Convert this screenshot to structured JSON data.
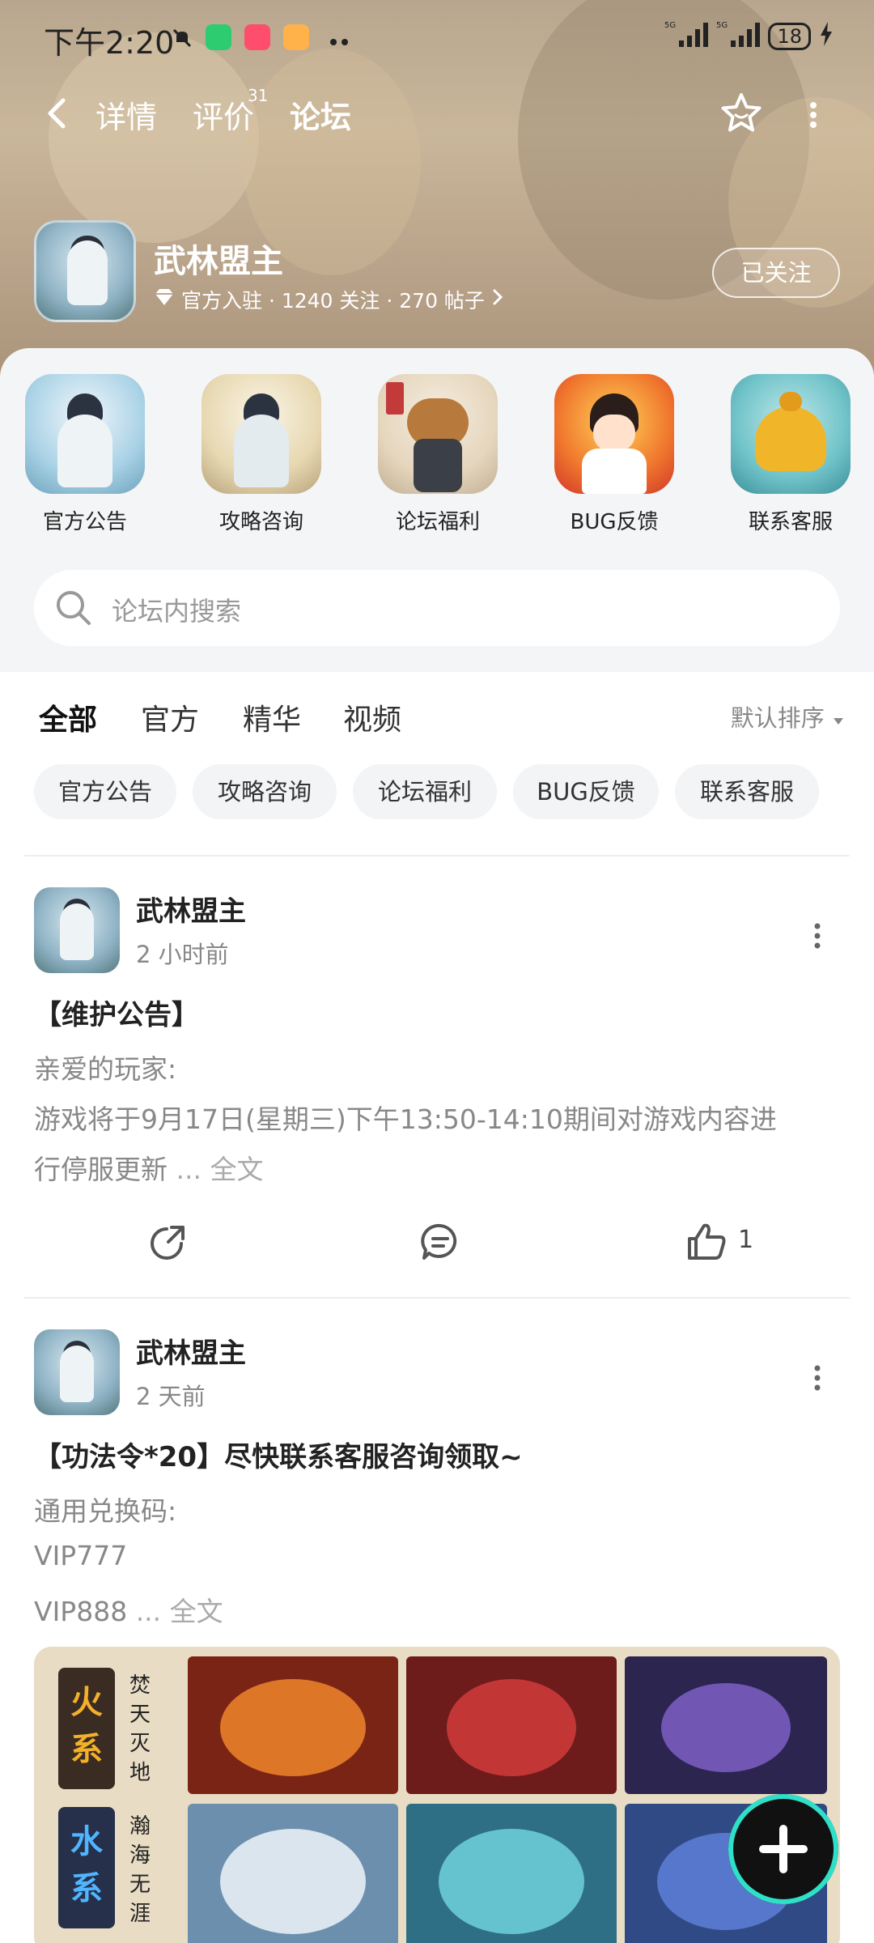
{
  "status_bar": {
    "time": "下午2:20",
    "battery": "18",
    "net1": "5G",
    "net2": "5G"
  },
  "nav": {
    "tabs": [
      {
        "label": "详情"
      },
      {
        "label": "评价",
        "badge": "31"
      },
      {
        "label": "论坛"
      }
    ],
    "active_tab": "论坛"
  },
  "app": {
    "name": "武林盟主",
    "meta": "官方入驻 · 1240 关注 · 270 帖子",
    "follow_label": "已关注"
  },
  "categories": [
    {
      "label": "官方公告"
    },
    {
      "label": "攻略咨询"
    },
    {
      "label": "论坛福利"
    },
    {
      "label": "BUG反馈"
    },
    {
      "label": "联系客服"
    }
  ],
  "search": {
    "placeholder": "论坛内搜索"
  },
  "filter_tabs": [
    {
      "label": "全部"
    },
    {
      "label": "官方"
    },
    {
      "label": "精华"
    },
    {
      "label": "视频"
    }
  ],
  "sort_label": "默认排序",
  "chips": [
    {
      "label": "官方公告"
    },
    {
      "label": "攻略咨询"
    },
    {
      "label": "论坛福利"
    },
    {
      "label": "BUG反馈"
    },
    {
      "label": "联系客服"
    }
  ],
  "posts": [
    {
      "author": "武林盟主",
      "time": "2 小时前",
      "title": "【维护公告】",
      "lines": [
        "亲爱的玩家:",
        "游戏将于9月17日(星期三)下午13:50-14:10期间对游戏内容进",
        "行停服更新"
      ],
      "more_text": " ... 全文",
      "likes": "1"
    },
    {
      "author": "武林盟主",
      "time": "2 天前",
      "title": "【功法令*20】尽快联系客服咨询领取~",
      "lines": [
        "通用兑换码:",
        "VIP777",
        "VIP888"
      ],
      "more_text": " ... 全文"
    }
  ],
  "post_image": {
    "row1_label": "火系",
    "row1_sub": "焚天灭地",
    "row2_label": "水系",
    "row2_sub": "瀚海无涯"
  },
  "colors": {
    "accent": "#14d6b8",
    "hero_bg": "#bca88f"
  }
}
